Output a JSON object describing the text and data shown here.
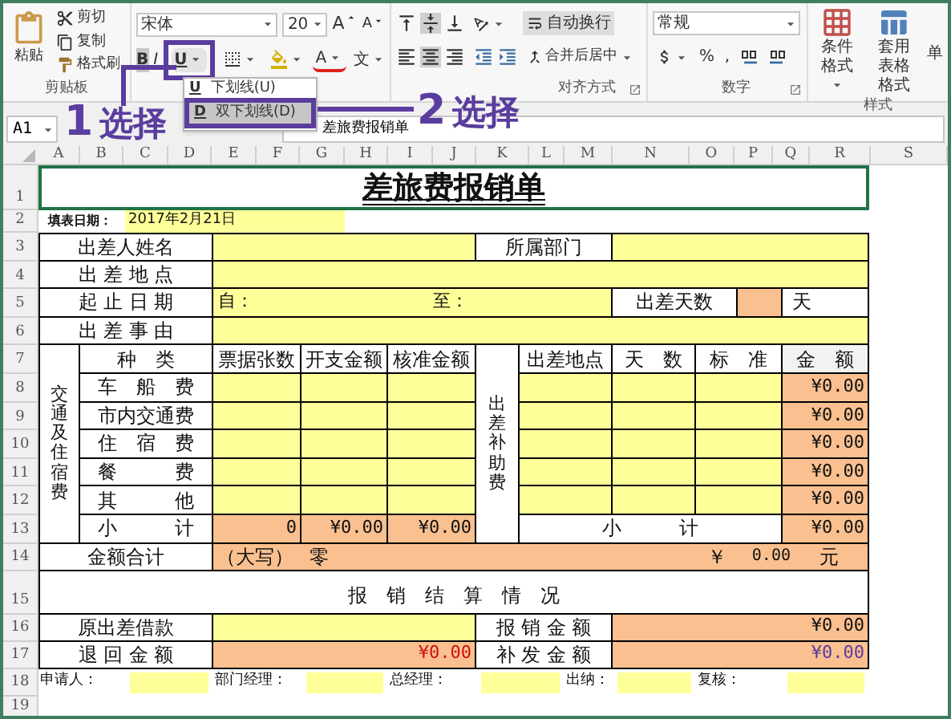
{
  "ribbon": {
    "clipboard": {
      "paste": "粘贴",
      "cut": "剪切",
      "copy": "复制",
      "format_painter": "格式刷",
      "label": "剪贴板"
    },
    "font": {
      "name": "宋体",
      "size": "20",
      "grow": "A",
      "shrink": "A",
      "bold": {
        "text": "B",
        "on": true
      },
      "italic": "I",
      "underline": "U",
      "font_color": "A",
      "phonetic": "文"
    },
    "alignment": {
      "wrap_text": "自动换行",
      "merge_center": "合并后居中",
      "label": "对齐方式"
    },
    "number": {
      "format": "常规",
      "percent": "%",
      "comma": ",",
      "label": "数字"
    },
    "styles": {
      "conditional_format": "条件格式",
      "table_format": [
        "套用",
        "表格格式"
      ],
      "cell_styles": "单",
      "label": "样式"
    }
  },
  "underline_menu": [
    {
      "key": "U",
      "label": "下划线(U)",
      "selected": false
    },
    {
      "key": "D",
      "label": "双下划线(D)",
      "selected": true
    }
  ],
  "callouts": [
    {
      "number": "1",
      "text": "选择"
    },
    {
      "number": "2",
      "text": "选择"
    }
  ],
  "formula_bar": {
    "name_box": "A1",
    "content": "差旅费报销单"
  },
  "column_headers": [
    "A",
    "B",
    "C",
    "D",
    "E",
    "F",
    "G",
    "H",
    "I",
    "J",
    "K",
    "L",
    "M",
    "N",
    "O",
    "P",
    "Q",
    "R",
    "S"
  ],
  "row_headers": [
    "1",
    "2",
    "3",
    "4",
    "5",
    "6",
    "7",
    "8",
    "9",
    "10",
    "11",
    "12",
    "13",
    "14",
    "15",
    "16",
    "17",
    "18",
    "19"
  ],
  "form": {
    "title": "差旅费报销单",
    "fill_date": {
      "label": "填表日期：",
      "value": "2017年2月21日"
    },
    "traveler": {
      "label": "出差人姓名",
      "department_label": "所属部门"
    },
    "destination_label": "出 差 地 点",
    "period": {
      "label": "起 止 日 期",
      "from": "自：",
      "to": "至：",
      "days_label": "出差天数",
      "days_unit": "天"
    },
    "purpose_label": "出 差 事 由",
    "transport": {
      "group_label": "交通及住宿费",
      "columns": [
        "种　类",
        "票据张数",
        "开支金额",
        "核准金额"
      ],
      "items": [
        "车　船　费",
        "市内交通费",
        "住　宿　费",
        "餐　　　费",
        "其　　　他"
      ],
      "subtotal": {
        "label": "小　　　计",
        "values": [
          "0",
          "¥0.00",
          "¥0.00"
        ]
      }
    },
    "allowance": {
      "group_label": "出差补助费",
      "columns": [
        "出差地点",
        "天　数",
        "标　准",
        "金　额"
      ],
      "amounts": [
        "¥0.00",
        "¥0.00",
        "¥0.00",
        "¥0.00",
        "¥0.00"
      ],
      "subtotal": {
        "label": "小　　　计",
        "amount": "¥0.00"
      }
    },
    "total": {
      "label": "金额合计",
      "uppercase_label": "（大写）",
      "uppercase_value": "零",
      "currency": "￥",
      "amount": "0.00",
      "unit": "元"
    },
    "settlement": {
      "heading": "报　销　结　算　情　况",
      "advance_label": "原出差借款",
      "reimbursed_label": "报 销 金 额",
      "reimbursed_amount": "¥0.00",
      "refund_label": "退 回 金 额",
      "refund_amount": "¥0.00",
      "supplement_label": "补 发 金 额",
      "supplement_amount": "¥0.00"
    },
    "signatures": [
      "申请人：",
      "部门经理：",
      "总经理：",
      "出纳：",
      "复核："
    ]
  }
}
